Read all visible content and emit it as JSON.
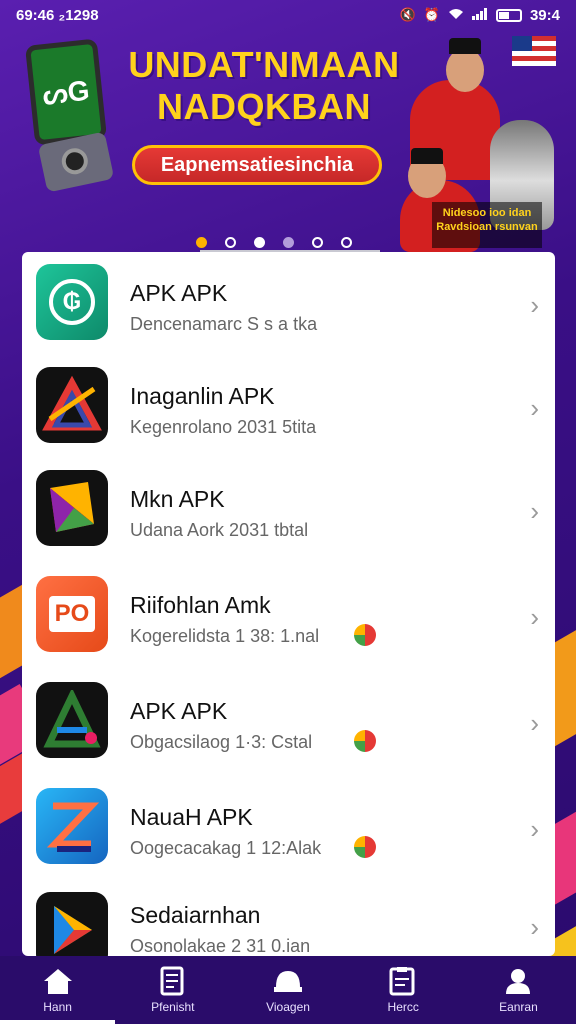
{
  "status_bar": {
    "left_text": "69:46 ₂1298",
    "right_time": "39:4"
  },
  "banner": {
    "tablet_text": "ᔕG",
    "title_line1": "UNDAT'NMAAN",
    "title_line2": "NADQKBAN",
    "pill_text": "Eapnemsatiesinchia",
    "caption": "Nidesoo ioo idan Ravdsioan rsunvan",
    "dots": [
      "active-orange",
      "outline",
      "filled",
      "purple",
      "outline",
      "outline"
    ]
  },
  "apps": [
    {
      "name": "APK APK",
      "subtitle": "Dencenamarc S s a tka",
      "icon": "teal-circle-icon",
      "icon_text": "₲",
      "badge": false
    },
    {
      "name": "Inaganlin APK",
      "subtitle": "Kegenrolano 2031 5tita",
      "icon": "dark-triangle-icon",
      "icon_text": "A",
      "badge": false
    },
    {
      "name": "Mkn APK",
      "subtitle": "Udana Aork 2031 tbtal",
      "icon": "dark-fold-icon",
      "icon_text": "◤",
      "badge": false
    },
    {
      "name": "Riifohlan Amk",
      "subtitle": "Kogerelidsta 1 38: 1.nal",
      "icon": "orange-po-icon",
      "icon_text": "PO",
      "badge": true
    },
    {
      "name": "APK APK",
      "subtitle": "Obgacsilaog 1·3: Cstal",
      "icon": "dark-a-icon",
      "icon_text": "A",
      "badge": true
    },
    {
      "name": "NauaH APK",
      "subtitle": "Oogecacakag 1 12:Alak",
      "icon": "blue-z-icon",
      "icon_text": "Z",
      "badge": true
    },
    {
      "name": "Sedaiarnhan",
      "subtitle": "Osonolakae 2 31 0.ian",
      "icon": "dark-play-icon",
      "icon_text": "▶",
      "badge": false
    }
  ],
  "nav": [
    {
      "label": "Hann",
      "icon": "home-icon"
    },
    {
      "label": "Pfenisht",
      "icon": "document-icon"
    },
    {
      "label": "Vioagen",
      "icon": "dome-icon"
    },
    {
      "label": "Hercc",
      "icon": "clipboard-icon"
    },
    {
      "label": "Eanran",
      "icon": "profile-icon"
    }
  ],
  "colors": {
    "background": "#3a0f86",
    "accent_yellow": "#ffd21c",
    "pill_red": "#e53935",
    "nav_bg": "#2a0c6a"
  }
}
